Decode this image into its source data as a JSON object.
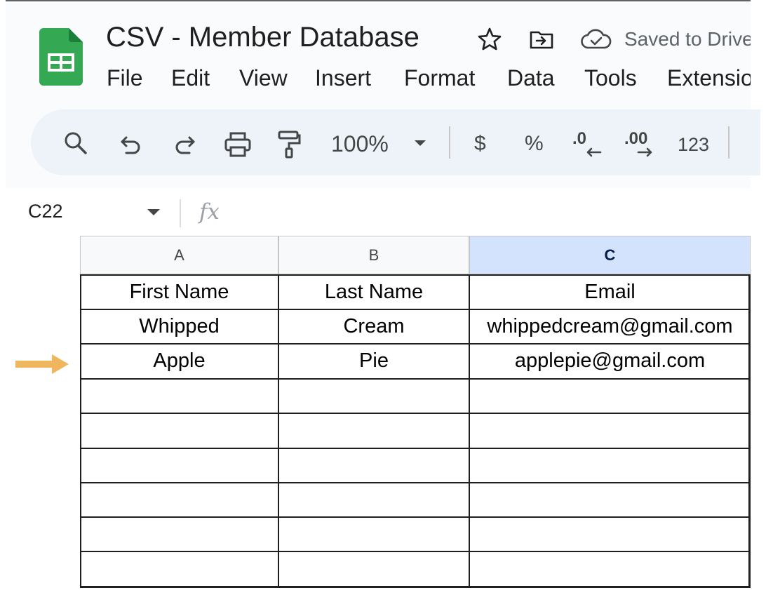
{
  "app": {
    "title": "CSV - Member Database",
    "save_status": "Saved to Drive"
  },
  "menu": [
    "File",
    "Edit",
    "View",
    "Insert",
    "Format",
    "Data",
    "Tools",
    "Extensions"
  ],
  "toolbar": {
    "zoom": "100%",
    "currency": "$",
    "percent": "%",
    "decrease_decimal": ".0",
    "increase_decimal": ".00",
    "number_format": "123"
  },
  "formula_bar": {
    "name_box": "C22",
    "fx_label": "fx",
    "value": ""
  },
  "sheet": {
    "columns": [
      "A",
      "B",
      "C"
    ],
    "selected_column": "C",
    "rows": [
      [
        "First Name",
        "Last Name",
        "Email"
      ],
      [
        "Whipped",
        "Cream",
        "whippedcream@gmail.com"
      ],
      [
        "Apple",
        "Pie",
        "applepie@gmail.com"
      ],
      [
        "",
        "",
        ""
      ],
      [
        "",
        "",
        ""
      ],
      [
        "",
        "",
        ""
      ],
      [
        "",
        "",
        ""
      ],
      [
        "",
        "",
        ""
      ],
      [
        "",
        "",
        ""
      ]
    ],
    "highlighted_row_index": 2
  },
  "colors": {
    "accent_arrow": "#f0b65e",
    "sheets_green": "#34a853",
    "selected_header": "#d3e3fd"
  },
  "icons": [
    "sheets-logo-icon",
    "star-icon",
    "move-to-folder-icon",
    "cloud-saved-icon",
    "search-icon",
    "undo-icon",
    "redo-icon",
    "print-icon",
    "paint-format-icon",
    "chevron-down-icon",
    "fx-icon",
    "arrow-right-icon"
  ]
}
